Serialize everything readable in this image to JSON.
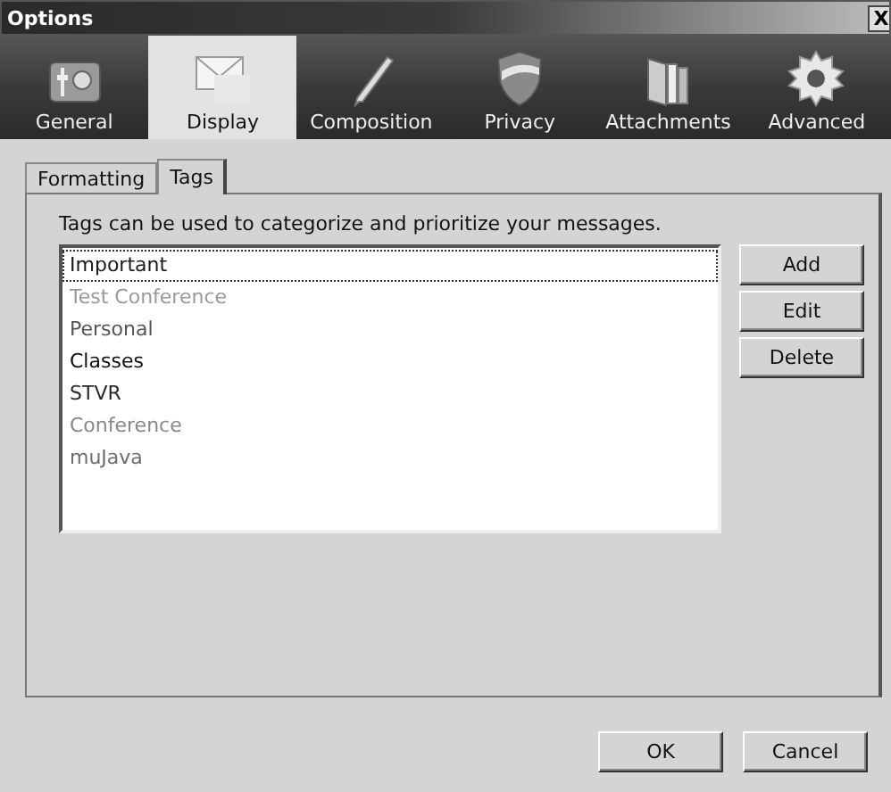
{
  "window": {
    "title": "Options",
    "close": "X"
  },
  "toolbar": [
    {
      "label": "General",
      "kind": "general",
      "selected": false
    },
    {
      "label": "Display",
      "kind": "display",
      "selected": true
    },
    {
      "label": "Composition",
      "kind": "composition",
      "selected": false
    },
    {
      "label": "Privacy",
      "kind": "privacy",
      "selected": false
    },
    {
      "label": "Attachments",
      "kind": "attachments",
      "selected": false
    },
    {
      "label": "Advanced",
      "kind": "advanced",
      "selected": false
    }
  ],
  "tabs": [
    {
      "label": "Formatting",
      "selected": false
    },
    {
      "label": "Tags",
      "selected": true
    }
  ],
  "description": "Tags can be used to categorize and prioritize your messages.",
  "tags": [
    {
      "name": "Important",
      "color": "#1a1a1a",
      "selected": true
    },
    {
      "name": "Test Conference",
      "color": "#9a9a9a",
      "selected": false
    },
    {
      "name": "Personal",
      "color": "#555555",
      "selected": false
    },
    {
      "name": "Classes",
      "color": "#111111",
      "selected": false
    },
    {
      "name": "STVR",
      "color": "#2a2a2a",
      "selected": false
    },
    {
      "name": "Conference",
      "color": "#888888",
      "selected": false
    },
    {
      "name": "muJava",
      "color": "#6e6e6e",
      "selected": false
    }
  ],
  "side_buttons": [
    "Add",
    "Edit",
    "Delete"
  ],
  "buttons": [
    "OK",
    "Cancel"
  ]
}
